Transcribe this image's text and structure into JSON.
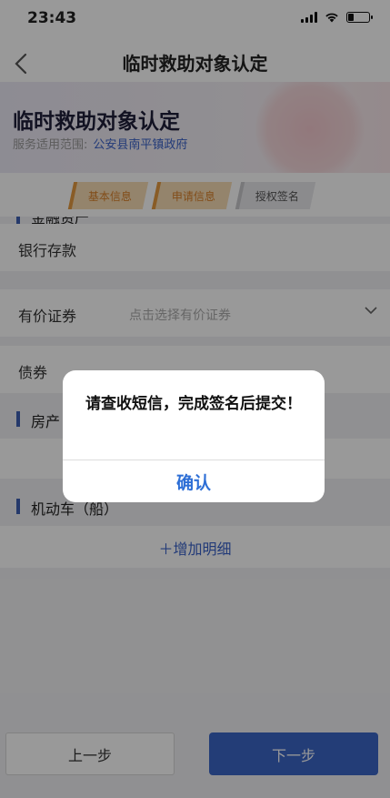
{
  "status": {
    "time": "23:43",
    "battery_level": 0.3
  },
  "nav": {
    "back_icon": "chevron-left-icon",
    "title": "临时救助对象认定"
  },
  "hero": {
    "title": "临时救助对象认定",
    "scope_label": "服务适用范围:",
    "scope_value": "公安县南平镇政府"
  },
  "steps": [
    {
      "label": "基本信息",
      "state": "active"
    },
    {
      "label": "申请信息",
      "state": "active"
    },
    {
      "label": "授权签名",
      "state": "inactive"
    }
  ],
  "form": {
    "section_finance": "金融资产",
    "bank_deposit": "银行存款",
    "securities": {
      "label": "有价证券",
      "placeholder": "点击选择有价证券"
    },
    "bonds": "债券",
    "section_property": "房产",
    "section_vehicle": "机动车（船）",
    "add_detail": "＋增加明细"
  },
  "footer": {
    "prev": "上一步",
    "next": "下一步"
  },
  "dialog": {
    "message": "请查收短信，完成签名后提交！",
    "confirm": "确认"
  },
  "colors": {
    "accent": "#3b66c6",
    "step_active": "#f7dcb4",
    "link": "#3a62c9"
  }
}
